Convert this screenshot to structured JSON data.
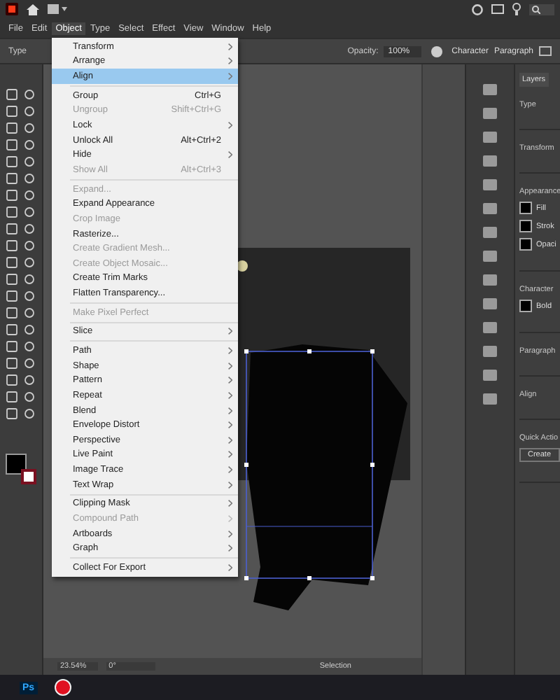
{
  "menu_bar": [
    {
      "label": "File",
      "selected": false
    },
    {
      "label": "Edit",
      "selected": false
    },
    {
      "label": "Object",
      "selected": true
    },
    {
      "label": "Type",
      "selected": false
    },
    {
      "label": "Select",
      "selected": false
    },
    {
      "label": "Effect",
      "selected": false
    },
    {
      "label": "View",
      "selected": false
    },
    {
      "label": "Window",
      "selected": false
    },
    {
      "label": "Help",
      "selected": false
    }
  ],
  "control_bar": {
    "type_label": "Type",
    "opacity_label": "Opacity:",
    "opacity_value": "100%",
    "links": [
      "Character",
      "Paragraph"
    ]
  },
  "object_menu": [
    {
      "kind": "item",
      "label": "Transform",
      "submenu": true,
      "disabled": false,
      "selected": false
    },
    {
      "kind": "item",
      "label": "Arrange",
      "submenu": true,
      "disabled": false,
      "selected": false
    },
    {
      "kind": "item",
      "label": "Align",
      "submenu": true,
      "disabled": false,
      "selected": true
    },
    {
      "kind": "separator"
    },
    {
      "kind": "item",
      "label": "Group",
      "shortcut": "Ctrl+G",
      "submenu": false,
      "disabled": false,
      "selected": false
    },
    {
      "kind": "item",
      "label": "Ungroup",
      "shortcut": "Shift+Ctrl+G",
      "submenu": false,
      "disabled": true,
      "selected": false
    },
    {
      "kind": "item",
      "label": "Lock",
      "submenu": true,
      "disabled": false,
      "selected": false
    },
    {
      "kind": "item",
      "label": "Unlock All",
      "shortcut": "Alt+Ctrl+2",
      "submenu": false,
      "disabled": false,
      "selected": false
    },
    {
      "kind": "item",
      "label": "Hide",
      "submenu": true,
      "disabled": false,
      "selected": false
    },
    {
      "kind": "item",
      "label": "Show All",
      "shortcut": "Alt+Ctrl+3",
      "submenu": false,
      "disabled": true,
      "selected": false
    },
    {
      "kind": "separator"
    },
    {
      "kind": "item",
      "label": "Expand...",
      "submenu": false,
      "disabled": true,
      "selected": false
    },
    {
      "kind": "item",
      "label": "Expand Appearance",
      "submenu": false,
      "disabled": false,
      "selected": false
    },
    {
      "kind": "item",
      "label": "Crop Image",
      "submenu": false,
      "disabled": true,
      "selected": false
    },
    {
      "kind": "item",
      "label": "Rasterize...",
      "submenu": false,
      "disabled": false,
      "selected": false
    },
    {
      "kind": "item",
      "label": "Create Gradient Mesh...",
      "submenu": false,
      "disabled": true,
      "selected": false
    },
    {
      "kind": "item",
      "label": "Create Object Mosaic...",
      "submenu": false,
      "disabled": true,
      "selected": false
    },
    {
      "kind": "item",
      "label": "Create Trim Marks",
      "submenu": false,
      "disabled": false,
      "selected": false
    },
    {
      "kind": "item",
      "label": "Flatten Transparency...",
      "submenu": false,
      "disabled": false,
      "selected": false
    },
    {
      "kind": "separator"
    },
    {
      "kind": "item",
      "label": "Make Pixel Perfect",
      "submenu": false,
      "disabled": true,
      "selected": false
    },
    {
      "kind": "separator"
    },
    {
      "kind": "item",
      "label": "Slice",
      "submenu": true,
      "disabled": false,
      "selected": false
    },
    {
      "kind": "separator"
    },
    {
      "kind": "item",
      "label": "Path",
      "submenu": true,
      "disabled": false,
      "selected": false
    },
    {
      "kind": "item",
      "label": "Shape",
      "submenu": true,
      "disabled": false,
      "selected": false
    },
    {
      "kind": "item",
      "label": "Pattern",
      "submenu": true,
      "disabled": false,
      "selected": false
    },
    {
      "kind": "item",
      "label": "Repeat",
      "submenu": true,
      "disabled": false,
      "selected": false
    },
    {
      "kind": "item",
      "label": "Blend",
      "submenu": true,
      "disabled": false,
      "selected": false
    },
    {
      "kind": "item",
      "label": "Envelope Distort",
      "submenu": true,
      "disabled": false,
      "selected": false
    },
    {
      "kind": "item",
      "label": "Perspective",
      "submenu": true,
      "disabled": false,
      "selected": false
    },
    {
      "kind": "item",
      "label": "Live Paint",
      "submenu": true,
      "disabled": false,
      "selected": false
    },
    {
      "kind": "item",
      "label": "Image Trace",
      "submenu": true,
      "disabled": false,
      "selected": false
    },
    {
      "kind": "item",
      "label": "Text Wrap",
      "submenu": true,
      "disabled": false,
      "selected": false
    },
    {
      "kind": "separator"
    },
    {
      "kind": "item",
      "label": "Clipping Mask",
      "submenu": true,
      "disabled": false,
      "selected": false
    },
    {
      "kind": "item",
      "label": "Compound Path",
      "submenu": true,
      "disabled": true,
      "selected": false
    },
    {
      "kind": "item",
      "label": "Artboards",
      "submenu": true,
      "disabled": false,
      "selected": false
    },
    {
      "kind": "item",
      "label": "Graph",
      "submenu": true,
      "disabled": false,
      "selected": false
    },
    {
      "kind": "separator"
    },
    {
      "kind": "item",
      "label": "Collect For Export",
      "submenu": true,
      "disabled": false,
      "selected": false
    }
  ],
  "status_bar": {
    "zoom": "23.54%",
    "rotation": "0°",
    "tool": "Selection"
  },
  "properties_panel": {
    "tab": "Layers",
    "sections": [
      {
        "title": "Type"
      },
      {
        "title": "Transform"
      },
      {
        "title": "Appearance",
        "rows": [
          "Fill",
          "Strok",
          "Opaci"
        ]
      },
      {
        "title": "Character",
        "rows": [
          "Bold"
        ]
      },
      {
        "title": "Paragraph"
      },
      {
        "title": "Align"
      },
      {
        "title": "Quick Actio",
        "button": "Create"
      }
    ]
  },
  "taskbar": {
    "apps": [
      {
        "kind": "photoshop",
        "label": "Ps"
      },
      {
        "kind": "record"
      }
    ]
  }
}
